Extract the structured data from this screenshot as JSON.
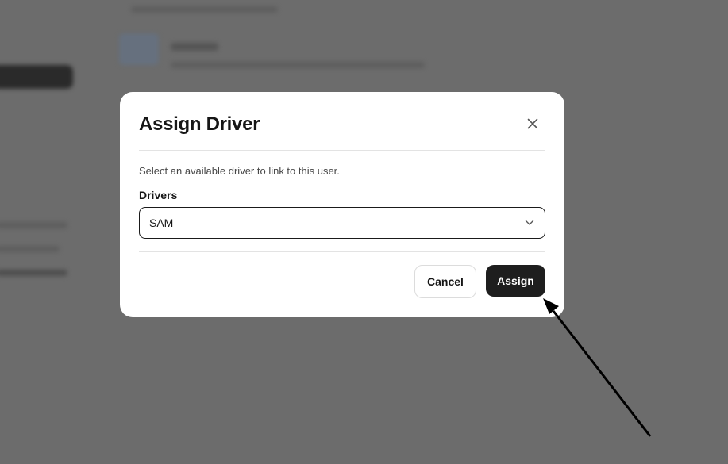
{
  "modal": {
    "title": "Assign Driver",
    "description": "Select an available driver to link to this user.",
    "field_label": "Drivers",
    "select_value": "SAM",
    "cancel_label": "Cancel",
    "assign_label": "Assign"
  },
  "icons": {
    "close": "close-icon",
    "dropdown": "chevron-down-icon",
    "pointer": "annotation-arrow"
  },
  "colors": {
    "overlay": "#6c6c6c",
    "primary_button": "#1e1e1e",
    "modal_bg": "#ffffff"
  }
}
